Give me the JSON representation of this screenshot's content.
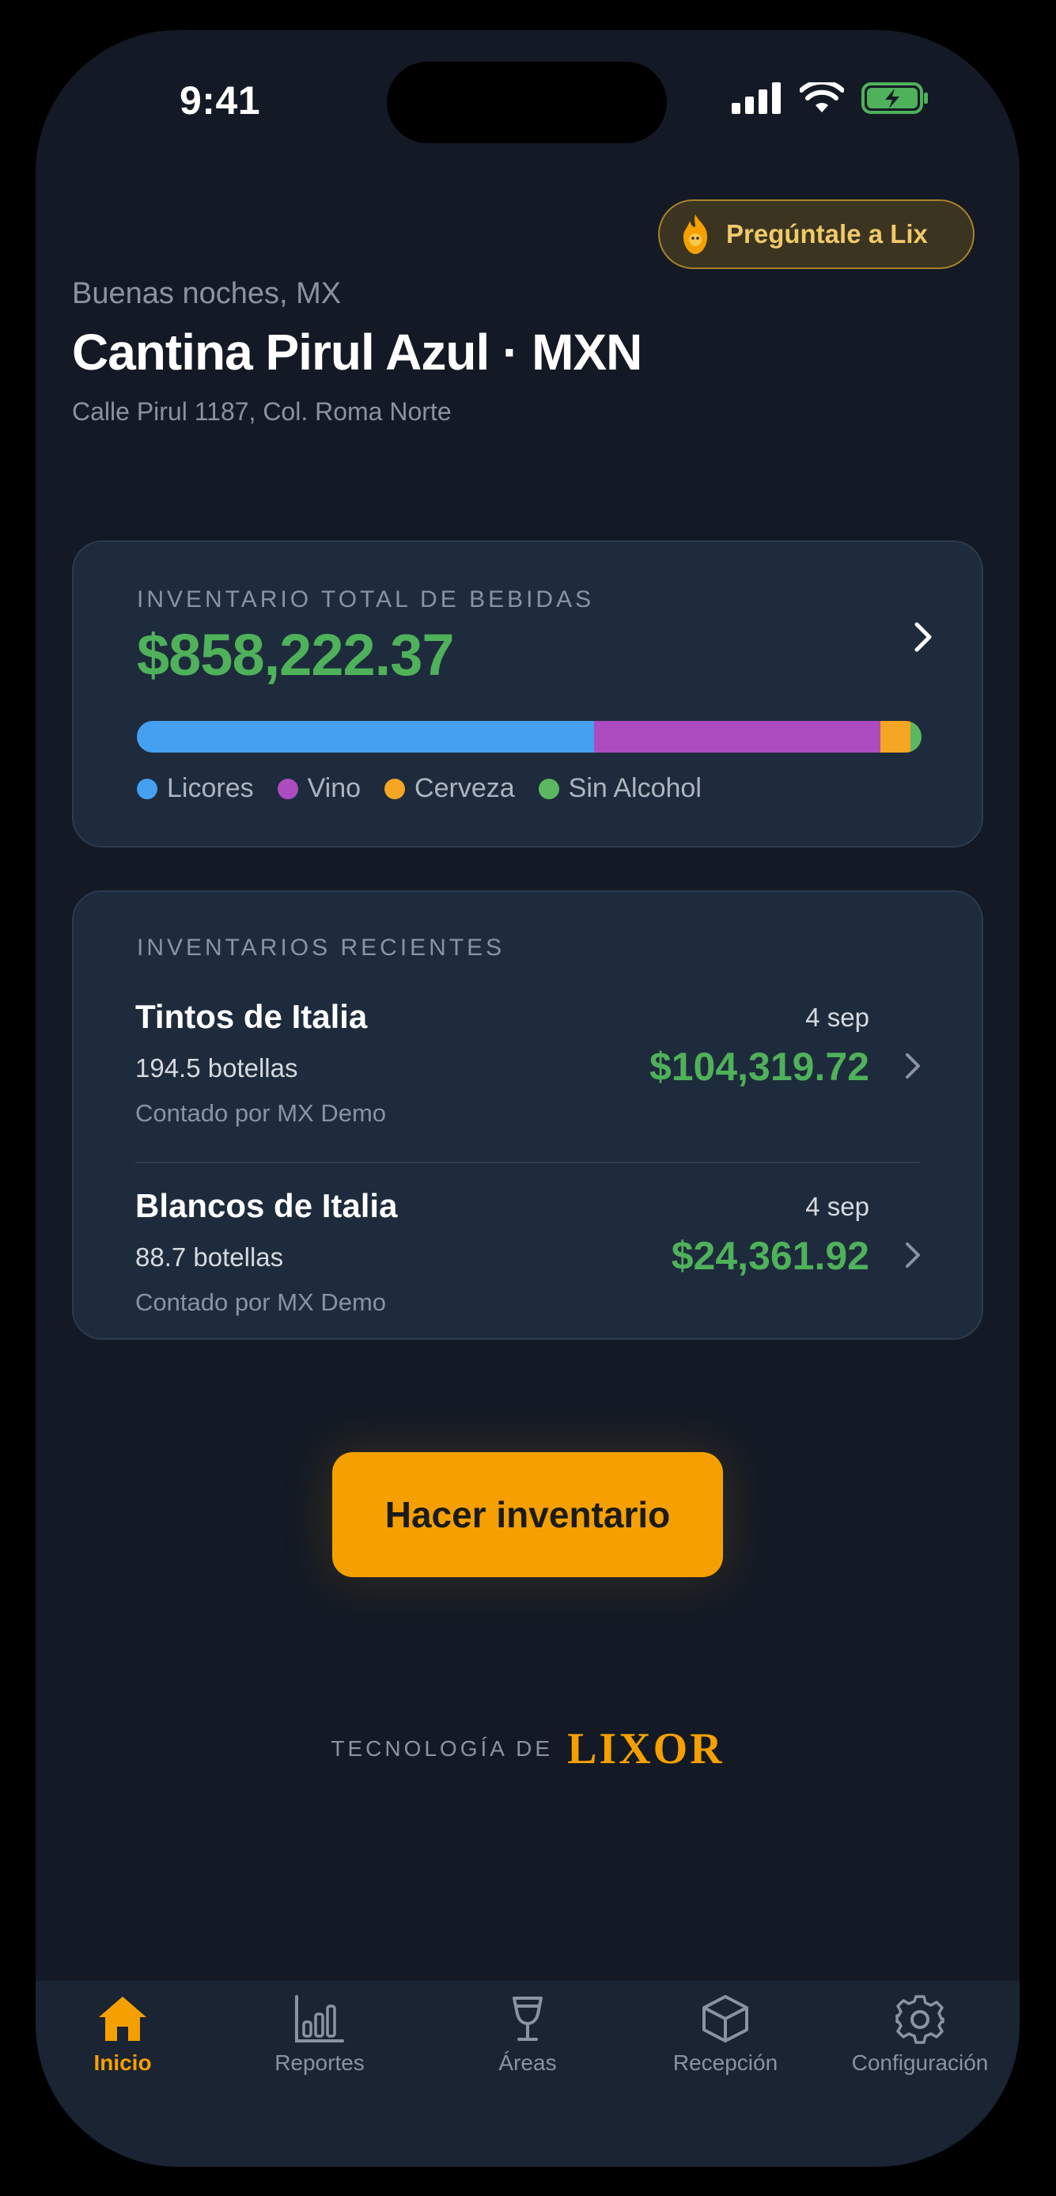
{
  "status_bar": {
    "time": "9:41"
  },
  "header": {
    "ask_lix_label": "Pregúntale a Lix",
    "greeting": "Buenas noches, MX",
    "venue_title": "Cantina Pirul Azul · MXN",
    "address": "Calle Pirul 1187, Col. Roma Norte"
  },
  "inventory_total": {
    "label": "INVENTARIO TOTAL DE BEBIDAS",
    "value": "$858,222.37",
    "breakdown": [
      {
        "name": "Licores",
        "color": "#46a0f0",
        "share": 0.583
      },
      {
        "name": "Vino",
        "color": "#ac4cc0",
        "share": 0.365
      },
      {
        "name": "Cerveza",
        "color": "#f5a623",
        "share": 0.038
      },
      {
        "name": "Sin Alcohol",
        "color": "#5cb860",
        "share": 0.014
      }
    ]
  },
  "recent": {
    "label": "INVENTARIOS RECIENTES",
    "items": [
      {
        "name": "Tintos de Italia",
        "bottles": "194.5 botellas",
        "counted_by": "Contado por MX Demo",
        "date": "4 sep",
        "value": "$104,319.72"
      },
      {
        "name": "Blancos de Italia",
        "bottles": "88.7 botellas",
        "counted_by": "Contado por MX Demo",
        "date": "4 sep",
        "value": "$24,361.92"
      }
    ]
  },
  "cta": {
    "label": "Hacer inventario"
  },
  "footer": {
    "powered_label": "TECNOLOGÍA DE",
    "brand": "LIXOR"
  },
  "tabs": [
    {
      "label": "Inicio",
      "icon": "home-icon",
      "active": true
    },
    {
      "label": "Reportes",
      "icon": "bar-chart-icon",
      "active": false
    },
    {
      "label": "Áreas",
      "icon": "wine-glass-icon",
      "active": false
    },
    {
      "label": "Recepción",
      "icon": "box-icon",
      "active": false
    },
    {
      "label": "Configuración",
      "icon": "gear-icon",
      "active": false
    }
  ],
  "colors": {
    "accent": "#f5a000",
    "positive": "#4fb15a",
    "background": "#131a25",
    "card": "#1e2b3c"
  }
}
